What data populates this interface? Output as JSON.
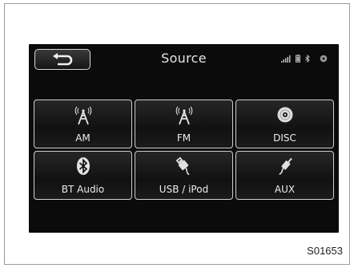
{
  "header": {
    "title": "Source",
    "back_icon": "return-arrow-icon",
    "status_icons": [
      "signal-strength-icon",
      "battery-icon",
      "bluetooth-icon",
      "disc-status-icon"
    ]
  },
  "sources": [
    {
      "label": "AM",
      "icon": "radio-antenna-icon"
    },
    {
      "label": "FM",
      "icon": "radio-antenna-icon"
    },
    {
      "label": "DISC",
      "icon": "disc-icon"
    },
    {
      "label": "BT Audio",
      "icon": "bluetooth-icon"
    },
    {
      "label": "USB / iPod",
      "icon": "usb-plug-icon"
    },
    {
      "label": "AUX",
      "icon": "aux-plug-icon"
    }
  ],
  "figure_id": "S01653",
  "colors": {
    "screen_bg": "#0b0b0b",
    "tile_border": "#cfcfcf",
    "text": "#ececec"
  }
}
